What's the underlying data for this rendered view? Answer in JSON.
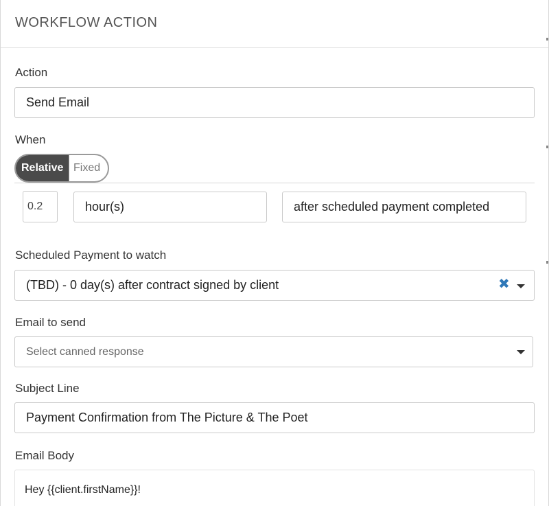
{
  "header": {
    "title": "WORKFLOW ACTION"
  },
  "action": {
    "label": "Action",
    "value": "Send Email"
  },
  "when": {
    "label": "When",
    "toggle": {
      "relative": "Relative",
      "fixed": "Fixed"
    },
    "amount": "0.2",
    "unit": "hour(s)",
    "trigger": "after scheduled payment completed"
  },
  "scheduled_payment": {
    "label": "Scheduled Payment to watch",
    "value": "(TBD) - 0 day(s) after contract signed by client"
  },
  "email_to_send": {
    "label": "Email to send",
    "placeholder": "Select canned response"
  },
  "subject": {
    "label": "Subject Line",
    "value": "Payment Confirmation from The Picture & The Poet"
  },
  "body": {
    "label": "Email Body",
    "value": "Hey {{client.firstName}}!"
  },
  "icons": {
    "clear": "clear-x-icon",
    "dropdown": "chevron-down-icon"
  },
  "colors": {
    "accent": "#2f78b8",
    "toggle_active": "#4a4a4a"
  }
}
